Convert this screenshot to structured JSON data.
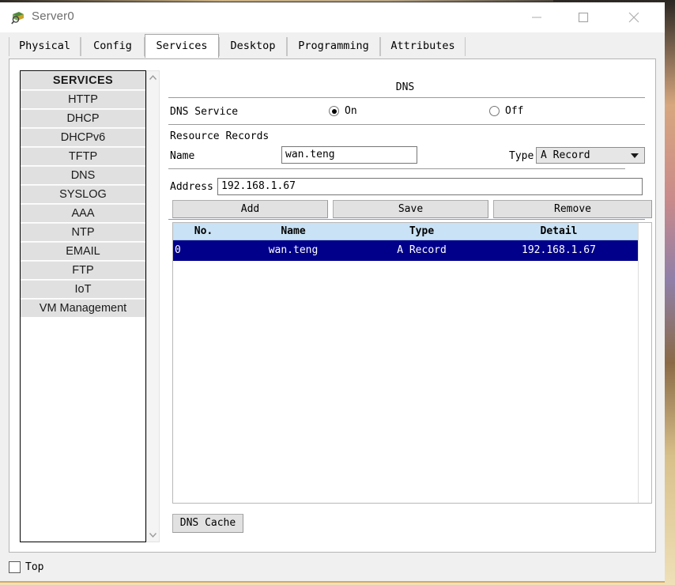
{
  "window": {
    "title": "Server0",
    "icon": "server-magnifier-icon",
    "minimize_label": "—",
    "maximize_label": "□",
    "close_label": "✕"
  },
  "tabs": [
    {
      "label": "Physical",
      "active": false
    },
    {
      "label": "Config",
      "active": false
    },
    {
      "label": "Services",
      "active": true
    },
    {
      "label": "Desktop",
      "active": false
    },
    {
      "label": "Programming",
      "active": false
    },
    {
      "label": "Attributes",
      "active": false
    }
  ],
  "sidebar": {
    "header": "SERVICES",
    "items": [
      {
        "label": "HTTP"
      },
      {
        "label": "DHCP"
      },
      {
        "label": "DHCPv6"
      },
      {
        "label": "TFTP"
      },
      {
        "label": "DNS"
      },
      {
        "label": "SYSLOG"
      },
      {
        "label": "AAA"
      },
      {
        "label": "NTP"
      },
      {
        "label": "EMAIL"
      },
      {
        "label": "FTP"
      },
      {
        "label": "IoT"
      },
      {
        "label": "VM Management"
      }
    ]
  },
  "pane": {
    "title": "DNS",
    "service_label": "DNS Service",
    "service_on_label": "On",
    "service_off_label": "Off",
    "service_state": "On",
    "resource_records_label": "Resource Records",
    "name_label": "Name",
    "name_value": "wan.teng",
    "type_label": "Type",
    "type_value": "A Record",
    "address_label": "Address",
    "address_value": "192.168.1.67",
    "add_label": "Add",
    "save_label": "Save",
    "remove_label": "Remove",
    "dns_cache_label": "DNS Cache"
  },
  "table": {
    "columns": [
      "No.",
      "Name",
      "Type",
      "Detail"
    ],
    "rows": [
      {
        "no": "0",
        "name": "wan.teng",
        "type": "A Record",
        "detail": "192.168.1.67",
        "selected": true
      }
    ],
    "selected_bg": "#00008b"
  },
  "footer": {
    "top_checkbox_label": "Top",
    "top_checked": false
  }
}
